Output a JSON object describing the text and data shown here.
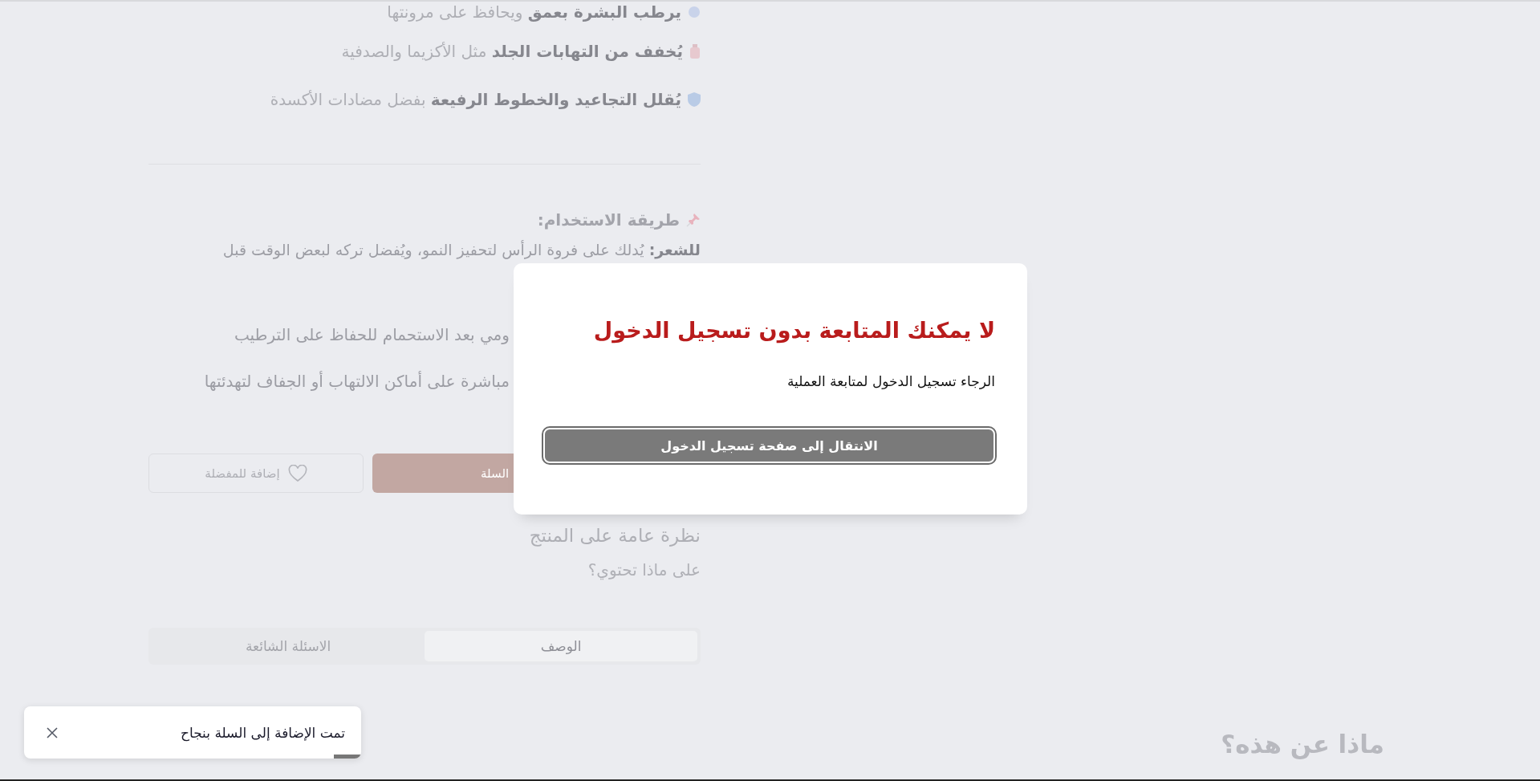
{
  "benefits": [
    {
      "kind": "droplet",
      "text": "**يرطب البشرة بعمق** ويحافظ على مرونتها"
    },
    {
      "kind": "bottle",
      "text": "**يُخفف من التهابات الجلد** مثل الأكزيما والصدفية"
    },
    {
      "kind": "shield",
      "text": "**يُقلل التجاعيد والخطوط الرفيعة** بفضل مضادات الأكسدة"
    }
  ],
  "usage": {
    "title": "طريقة الاستخدام:",
    "lines": [
      "**للشعر:** يُدلك على فروة الرأس لتحفيز النمو، ويُفضل تركه لبعض الوقت قبل",
      "ومي بعد الاستحمام للحفاظ على الترطيب",
      "مباشرة على أماكن الالتهاب أو الجفاف لتهدئتها"
    ]
  },
  "actions": {
    "cart": "السلة",
    "favorite": "إضافة للمفضلة"
  },
  "overview": {
    "title": "نظرة عامة على المنتج",
    "subtitle": "على ماذا تحتوي؟"
  },
  "tabs": [
    {
      "label": "الوصف",
      "selected": true
    },
    {
      "label": "الاسئلة الشائعة",
      "selected": false
    }
  ],
  "related_title": "ماذا عن هذه؟",
  "modal": {
    "title": "لا يمكنك المتابعة بدون تسجيل الدخول",
    "message": "الرجاء تسجيل الدخول لمتابعة العملية",
    "button": "الانتقال إلى صفحة تسجيل الدخول"
  },
  "toast": {
    "message": "تمت الإضافة إلى السلة بنجاح",
    "level": 0.08
  }
}
